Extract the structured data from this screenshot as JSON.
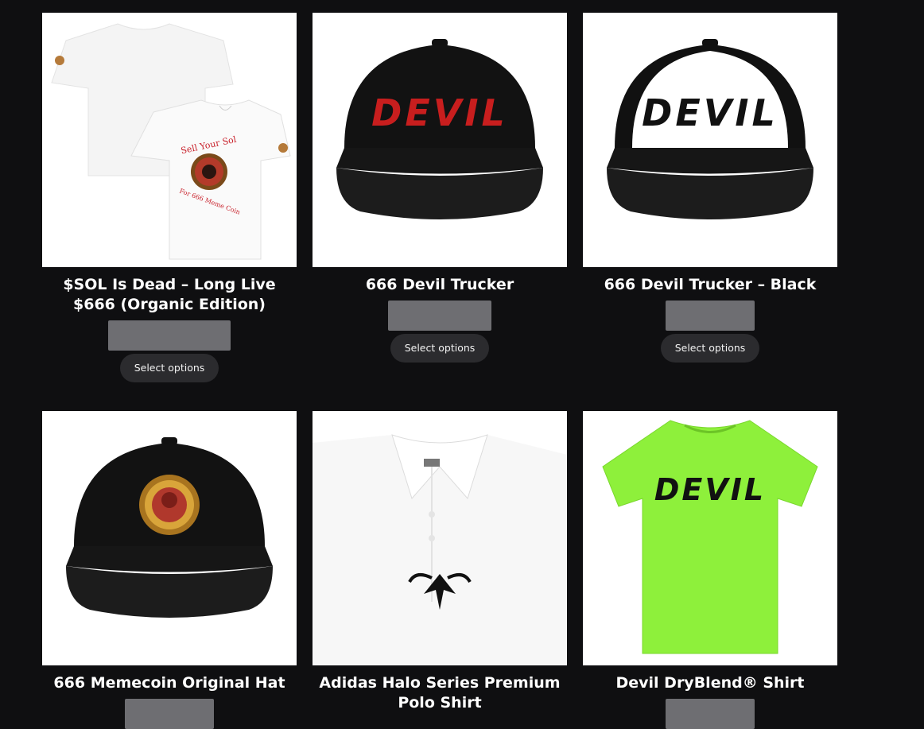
{
  "products": [
    {
      "title": "$SOL Is Dead – Long Live $666 (Organic Edition)",
      "button": "Select options",
      "image": {
        "type": "tshirt-pair",
        "print_top": "Sell Your Sol",
        "print_bottom": "For 666 Meme Coin",
        "shirt_color": "#ffffff"
      }
    },
    {
      "title": "666 Devil Trucker",
      "button": "Select options",
      "image": {
        "type": "trucker-cap",
        "front_color": "#111111",
        "print": "DEVIL",
        "print_color": "#c81e1e"
      }
    },
    {
      "title": "666 Devil Trucker – Black",
      "button": "Select options",
      "image": {
        "type": "trucker-cap",
        "front_color": "#ffffff",
        "print": "DEVIL",
        "print_color": "#111111"
      }
    },
    {
      "title": "666 Memecoin Original Hat",
      "image": {
        "type": "trucker-cap-coin",
        "front_color": "#111111"
      }
    },
    {
      "title": "Adidas Halo Series Premium Polo Shirt",
      "image": {
        "type": "polo",
        "shirt_color": "#ffffff"
      }
    },
    {
      "title": "Devil DryBlend® Shirt",
      "image": {
        "type": "tshirt",
        "shirt_color": "#8ef03b",
        "print": "DEVIL",
        "print_color": "#111111"
      }
    }
  ]
}
